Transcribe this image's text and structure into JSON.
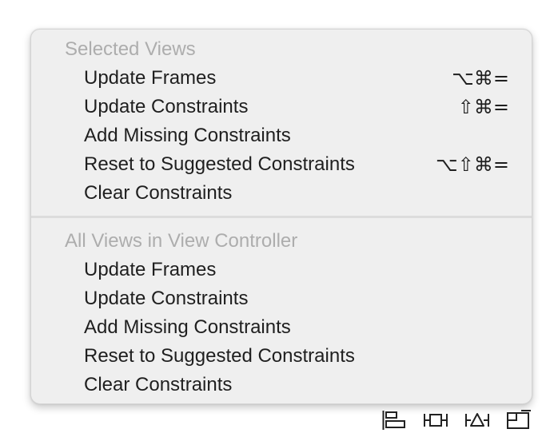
{
  "menu": {
    "sections": [
      {
        "header": "Selected Views",
        "items": [
          {
            "label": "Update Frames",
            "shortcut": "⌥⌘="
          },
          {
            "label": "Update Constraints",
            "shortcut": "⇧⌘="
          },
          {
            "label": "Add Missing Constraints",
            "shortcut": ""
          },
          {
            "label": "Reset to Suggested Constraints",
            "shortcut": "⌥⇧⌘="
          },
          {
            "label": "Clear Constraints",
            "shortcut": ""
          }
        ]
      },
      {
        "header": "All Views in View Controller",
        "items": [
          {
            "label": "Update Frames",
            "shortcut": ""
          },
          {
            "label": "Update Constraints",
            "shortcut": ""
          },
          {
            "label": "Add Missing Constraints",
            "shortcut": ""
          },
          {
            "label": "Reset to Suggested Constraints",
            "shortcut": ""
          },
          {
            "label": "Clear Constraints",
            "shortcut": ""
          }
        ]
      }
    ]
  },
  "toolbar": {
    "buttons": [
      {
        "icon": "align-icon"
      },
      {
        "icon": "pin-icon"
      },
      {
        "icon": "resolve-issues-icon"
      },
      {
        "icon": "resizing-behavior-icon"
      }
    ]
  },
  "colors": {
    "menu_background": "#efefef",
    "header_text": "#adadad",
    "item_text": "#1f1f1f",
    "separator": "#dcdcdc"
  }
}
